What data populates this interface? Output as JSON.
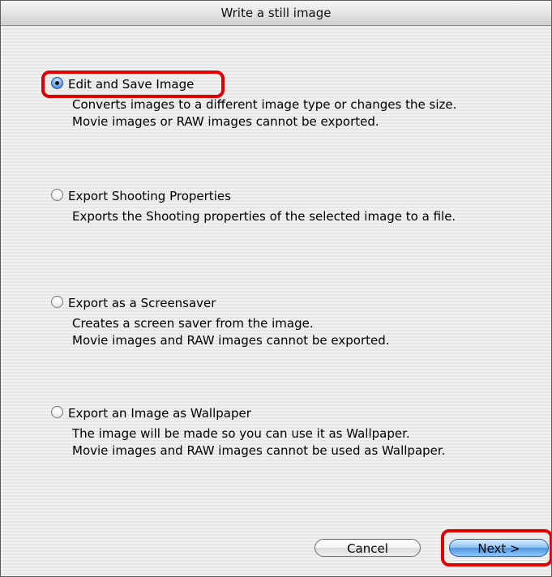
{
  "window": {
    "title": "Write a still image"
  },
  "options": [
    {
      "label": "Edit and Save Image",
      "selected": true,
      "description": [
        "Converts images to a different image type or changes the size.",
        "Movie images or RAW images cannot be exported."
      ]
    },
    {
      "label": "Export Shooting Properties",
      "selected": false,
      "description": [
        "Exports the Shooting properties of the selected image to a file."
      ]
    },
    {
      "label": "Export as a Screensaver",
      "selected": false,
      "description": [
        "Creates a screen saver from the image.",
        "Movie images and RAW images cannot be exported."
      ]
    },
    {
      "label": "Export an Image as Wallpaper",
      "selected": false,
      "description": [
        "The image will be made so you can use it as Wallpaper.",
        "Movie images and RAW images cannot be used as Wallpaper."
      ]
    }
  ],
  "buttons": {
    "cancel_label": "Cancel",
    "next_label": "Next >"
  },
  "colors": {
    "highlight": "#e00000",
    "default_button": "#4f95e2",
    "selected_radio": "#2f6fc6"
  }
}
